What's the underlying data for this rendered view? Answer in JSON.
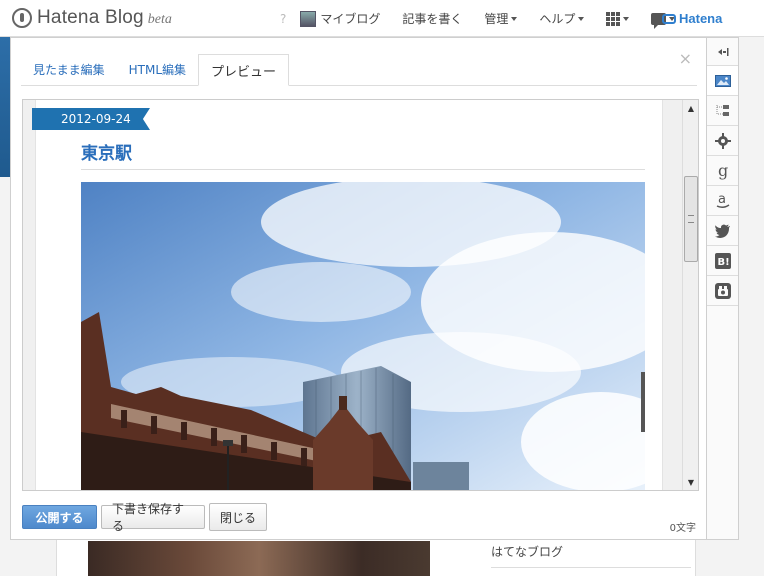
{
  "app": {
    "logo_text": "Hatena Blog",
    "logo_suffix": "beta"
  },
  "topnav": {
    "help_mark": "?",
    "my_blog": "マイブログ",
    "write_post": "記事を書く",
    "manage": "管理",
    "help": "ヘルプ",
    "brand": "Hatena"
  },
  "editor": {
    "tabs": [
      {
        "label": "見たまま編集",
        "active": false
      },
      {
        "label": "HTML編集",
        "active": false
      },
      {
        "label": "プレビュー",
        "active": true
      }
    ],
    "close_glyph": "×",
    "preview": {
      "date": "2012-09-24",
      "title": "東京駅"
    },
    "actions": {
      "publish": "公開する",
      "save_draft": "下書き保存する",
      "close": "閉じる"
    },
    "char_count": "0文字"
  },
  "sidebar_tools": [
    {
      "name": "collapse-icon"
    },
    {
      "name": "photo-icon"
    },
    {
      "name": "file-tree-icon"
    },
    {
      "name": "gear-icon"
    },
    {
      "name": "google-icon"
    },
    {
      "name": "amazon-icon"
    },
    {
      "name": "twitter-icon"
    },
    {
      "name": "hatena-bookmark-icon"
    },
    {
      "name": "fotolife-icon"
    }
  ],
  "background_page": {
    "sidebar_link": "はてなブログ"
  },
  "colors": {
    "accent": "#2a6ebb",
    "ribbon": "#1f72b0",
    "primary_button": "#5b93d3"
  }
}
